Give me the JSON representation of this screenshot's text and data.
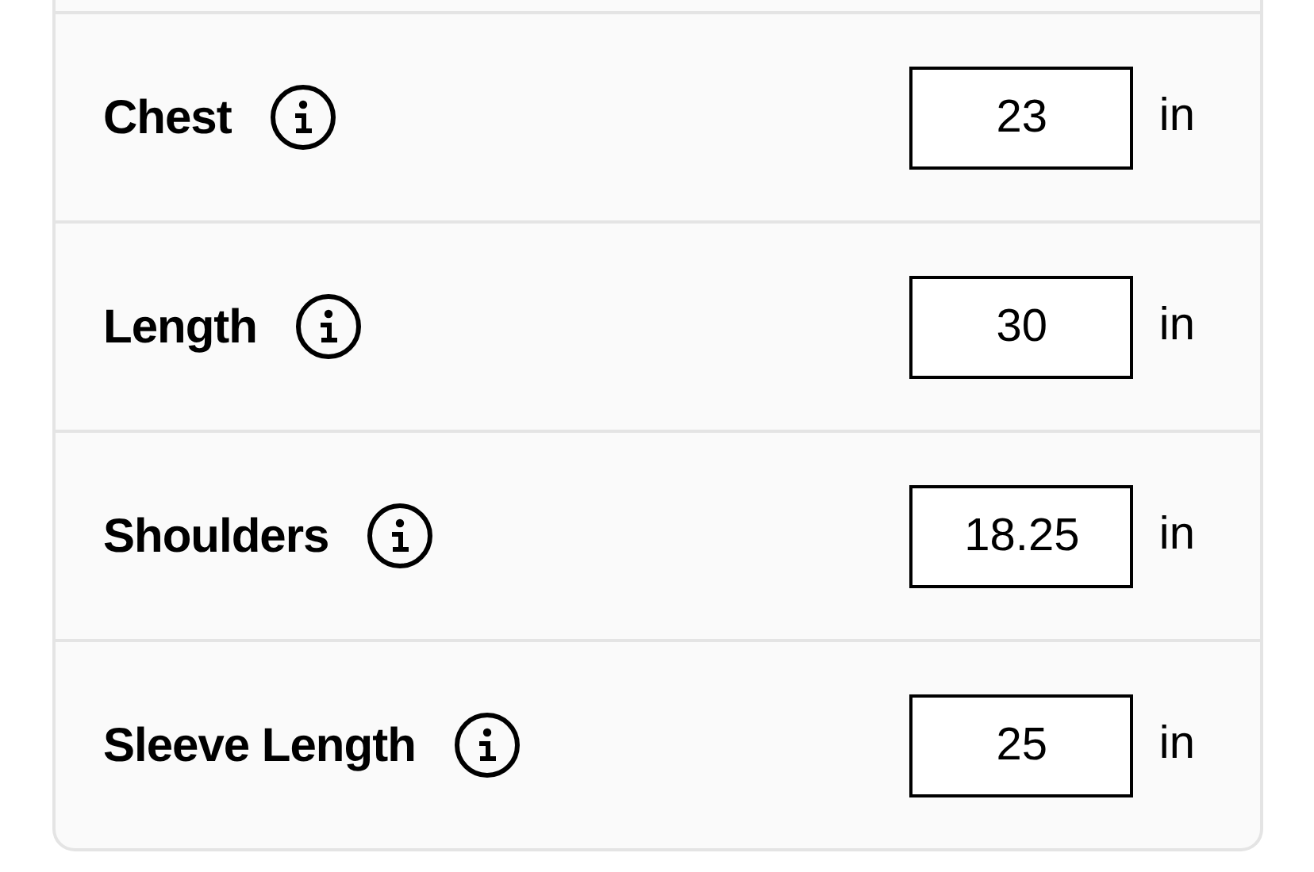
{
  "measurements": [
    {
      "label": "Chest",
      "value": "23",
      "unit": "in"
    },
    {
      "label": "Length",
      "value": "30",
      "unit": "in"
    },
    {
      "label": "Shoulders",
      "value": "18.25",
      "unit": "in"
    },
    {
      "label": "Sleeve Length",
      "value": "25",
      "unit": "in"
    }
  ]
}
